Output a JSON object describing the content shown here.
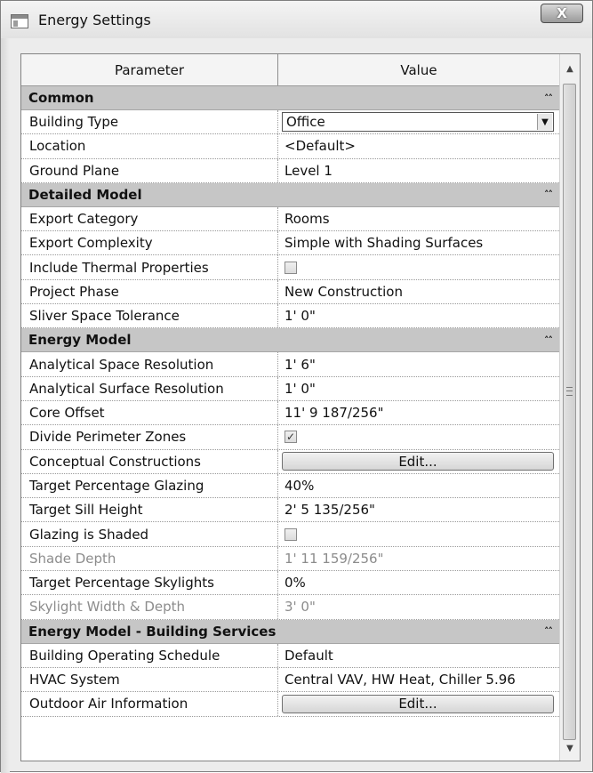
{
  "window": {
    "title": "Energy Settings",
    "close_glyph": "X"
  },
  "table": {
    "headers": {
      "parameter": "Parameter",
      "value": "Value"
    },
    "groups": [
      {
        "label": "Common",
        "chevron": "˄˄",
        "rows": [
          {
            "name": "Building Type",
            "value": "Office",
            "control": "select"
          },
          {
            "name": "Location",
            "value": "<Default>",
            "control": "text"
          },
          {
            "name": "Ground Plane",
            "value": "Level 1",
            "control": "text"
          }
        ]
      },
      {
        "label": "Detailed Model",
        "chevron": "˄˄",
        "rows": [
          {
            "name": "Export Category",
            "value": "Rooms",
            "control": "text"
          },
          {
            "name": "Export Complexity",
            "value": "Simple with Shading Surfaces",
            "control": "text"
          },
          {
            "name": "Include Thermal Properties",
            "value": "",
            "control": "checkbox",
            "checked": false
          },
          {
            "name": "Project Phase",
            "value": "New Construction",
            "control": "text"
          },
          {
            "name": "Sliver Space Tolerance",
            "value": "1'  0\"",
            "control": "text"
          }
        ]
      },
      {
        "label": "Energy Model",
        "chevron": "˄˄",
        "rows": [
          {
            "name": "Analytical Space Resolution",
            "value": "1'  6\"",
            "control": "text"
          },
          {
            "name": "Analytical Surface Resolution",
            "value": "1'  0\"",
            "control": "text"
          },
          {
            "name": "Core Offset",
            "value": "11'  9 187/256\"",
            "control": "text"
          },
          {
            "name": "Divide Perimeter Zones",
            "value": "",
            "control": "checkbox",
            "checked": true
          },
          {
            "name": "Conceptual Constructions",
            "value": "Edit...",
            "control": "button"
          },
          {
            "name": "Target Percentage Glazing",
            "value": "40%",
            "control": "text"
          },
          {
            "name": "Target Sill Height",
            "value": "2'  5 135/256\"",
            "control": "text"
          },
          {
            "name": "Glazing is Shaded",
            "value": "",
            "control": "checkbox",
            "checked": false
          },
          {
            "name": "Shade Depth",
            "value": "1'  11 159/256\"",
            "control": "text",
            "disabled": true
          },
          {
            "name": "Target Percentage Skylights",
            "value": "0%",
            "control": "text"
          },
          {
            "name": "Skylight Width & Depth",
            "value": "3'  0\"",
            "control": "text",
            "disabled": true
          }
        ]
      },
      {
        "label": "Energy Model - Building Services",
        "chevron": "˄˄",
        "rows": [
          {
            "name": "Building Operating Schedule",
            "value": "Default",
            "control": "text"
          },
          {
            "name": "HVAC System",
            "value": "Central VAV, HW Heat, Chiller 5.96",
            "control": "text"
          },
          {
            "name": "Outdoor Air Information",
            "value": "Edit...",
            "control": "button"
          }
        ]
      }
    ]
  },
  "scrollbar": {
    "up_glyph": "▲",
    "down_glyph": "▼"
  },
  "icons": {
    "window": "window-icon",
    "close": "close-icon",
    "dropdown": "chevron-down-icon",
    "collapse": "collapse-icon",
    "check": "checkmark-icon"
  }
}
